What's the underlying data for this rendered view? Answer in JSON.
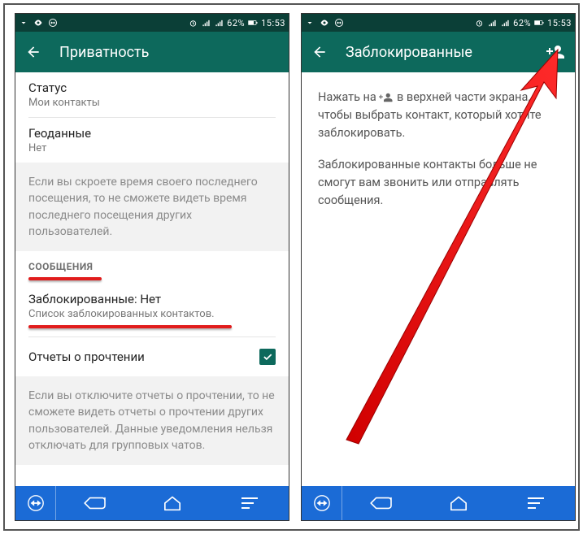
{
  "statusbar": {
    "battery": "62%",
    "time": "15:53"
  },
  "left": {
    "appbar": {
      "title": "Приватность"
    },
    "status_title": "Статус",
    "status_sub": "Мои контакты",
    "geo_title": "Геоданные",
    "geo_sub": "Нет",
    "note1": "Если вы скроете время своего последнего посещения, то не сможете видеть время последнего посещения других пользователей.",
    "section_messages": "СООБЩЕНИЯ",
    "blocked_title": "Заблокированные: Нет",
    "blocked_sub": "Список заблокированных контактов.",
    "read_reports": "Отчеты о прочтении",
    "note2": "Если вы отключите отчеты о прочтении, то не сможете видеть отчеты о прочтении других пользователей. Данные уведомления нельзя отключать для групповых чатов."
  },
  "right": {
    "appbar": {
      "title": "Заблокированные"
    },
    "para1a": "Нажать на ",
    "para1b": " в верхней части экрана, чтобы выбрать контакт, который хотите заблокировать.",
    "para2": "Заблокированные контакты больше не смогут вам звонить или отправлять сообщения."
  }
}
